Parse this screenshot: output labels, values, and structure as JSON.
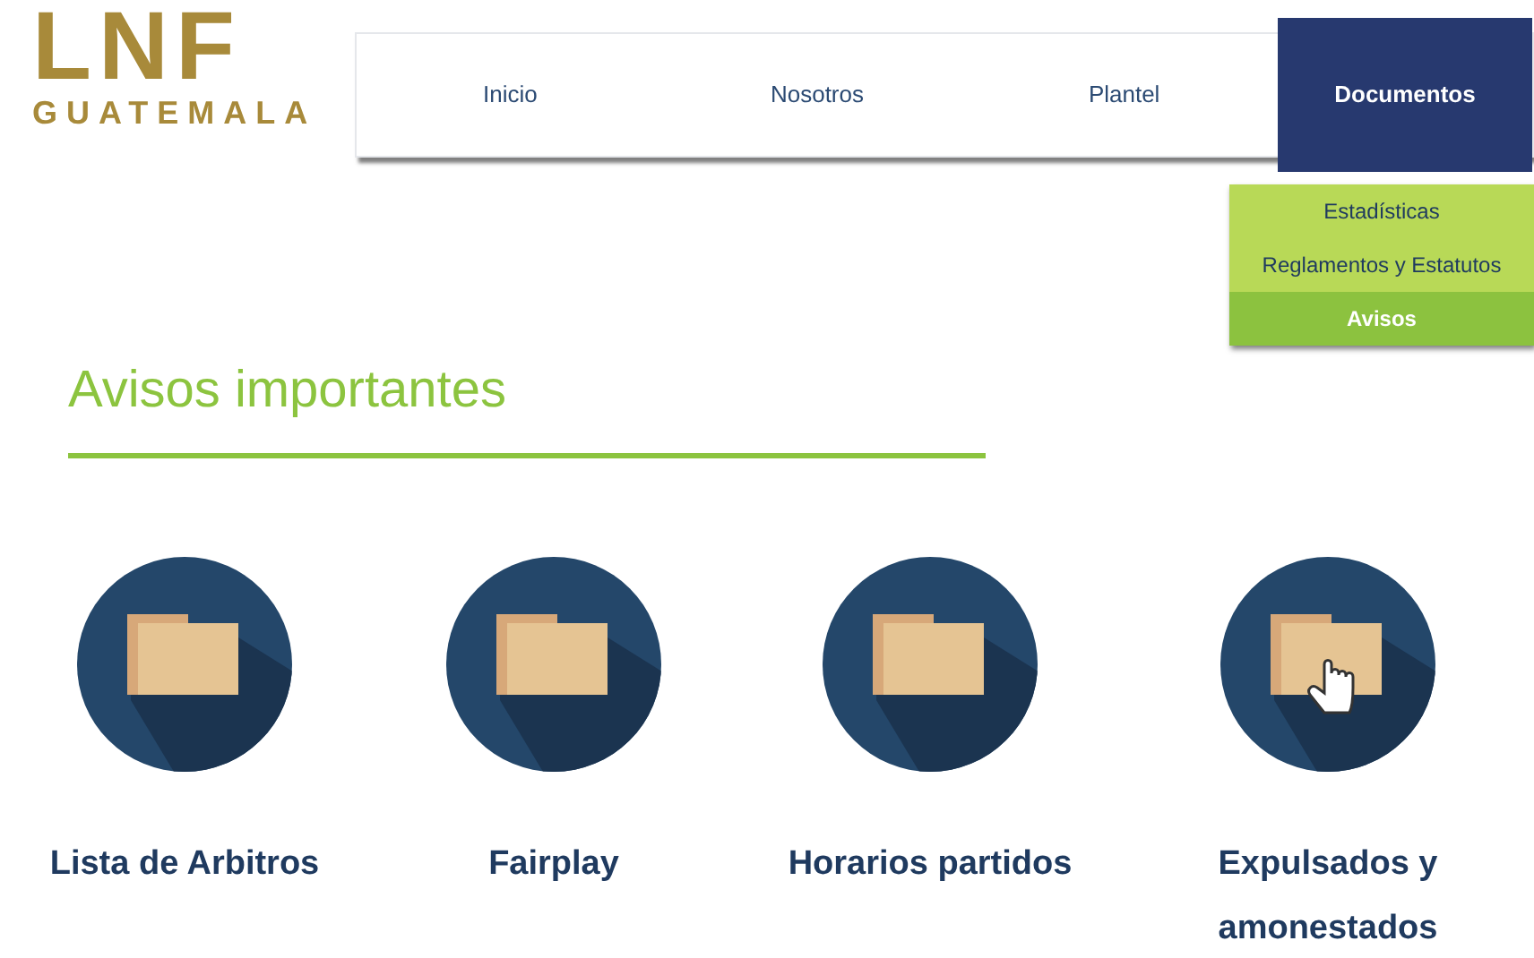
{
  "logo": {
    "mark": "LNF",
    "subtitle": "GUATEMALA"
  },
  "nav": [
    {
      "label": "Inicio",
      "selected": false
    },
    {
      "label": "Nosotros",
      "selected": false
    },
    {
      "label": "Plantel",
      "selected": false
    },
    {
      "label": "Documentos",
      "selected": true
    }
  ],
  "dropdown": [
    {
      "label": "Estadísticas",
      "selected": false
    },
    {
      "label": "Reglamentos y Estatutos",
      "selected": false
    },
    {
      "label": "Avisos",
      "selected": true
    }
  ],
  "heading": "Avisos importantes",
  "documents": [
    {
      "label": "Lista de Arbitros",
      "hovered": false
    },
    {
      "label": "Fairplay",
      "hovered": false
    },
    {
      "label": "Horarios partidos",
      "hovered": false
    },
    {
      "label": "Expulsados y amonestados",
      "hovered": true
    }
  ]
}
